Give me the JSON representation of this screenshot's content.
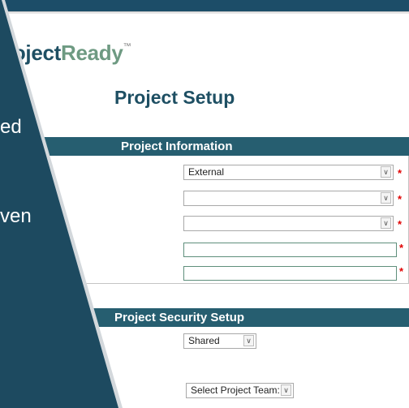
{
  "logo": {
    "text_dark": "roject",
    "text_light": "Ready",
    "tm": "™"
  },
  "page_title": "Project Setup",
  "sections": {
    "info": {
      "title": "Project Information"
    },
    "security": {
      "title": "Project Security Setup"
    }
  },
  "fields": {
    "type": {
      "value": "External"
    },
    "field2": {
      "value": ""
    },
    "field3": {
      "value": ""
    },
    "text1": {
      "value": ""
    },
    "text2": {
      "value": ""
    },
    "security_mode": {
      "value": "Shared"
    },
    "project_team": {
      "value": "Select Project Team:"
    }
  },
  "required_marker": "*",
  "panel": {
    "text1": "ed",
    "text2": "ven",
    "color": "#1d4a60",
    "edge_color": "#d3d8dc"
  },
  "colors": {
    "accent": "#265e70",
    "title": "#1e4f63",
    "logo_light": "#6e9a82",
    "required": "#e00000"
  }
}
